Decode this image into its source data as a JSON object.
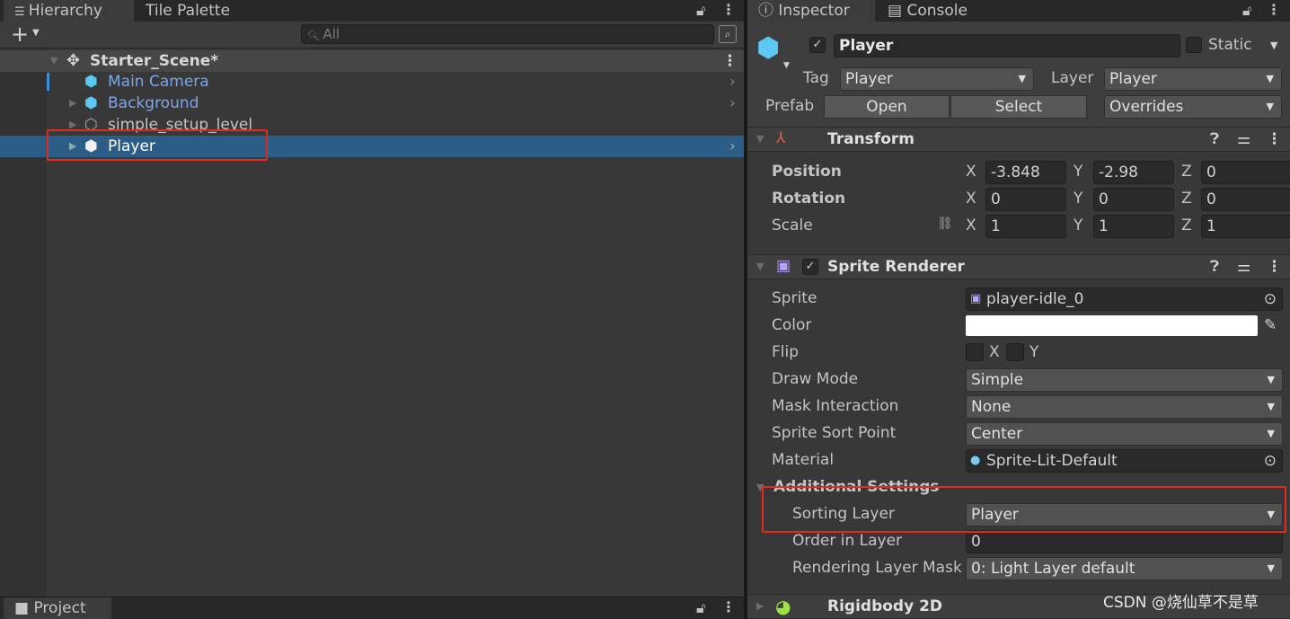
{
  "hierarchy": {
    "tabs": [
      {
        "label": "Hierarchy",
        "icon": "list-icon"
      },
      {
        "label": "Tile Palette"
      }
    ],
    "add_label": "+",
    "search_placeholder": "All",
    "scene": "Starter_Scene*",
    "items": [
      {
        "label": "Main Camera",
        "color": "#7ba7e8",
        "expandable": false
      },
      {
        "label": "Background",
        "color": "#7ba7e8",
        "expandable": true
      },
      {
        "label": "simple_setup_level",
        "color": "#c4c4c4",
        "expandable": true
      },
      {
        "label": "Player",
        "color": "#ffffff",
        "expandable": true,
        "selected": true
      }
    ]
  },
  "project": {
    "tab_label": "Project"
  },
  "inspector": {
    "tabs": [
      {
        "label": "Inspector",
        "icon": "info-icon"
      },
      {
        "label": "Console",
        "icon": "console-icon"
      }
    ],
    "object_name": "Player",
    "active": true,
    "static_label": "Static",
    "tag_label": "Tag",
    "tag_value": "Player",
    "layer_label": "Layer",
    "layer_value": "Player",
    "prefab_label": "Prefab",
    "open_label": "Open",
    "select_label": "Select",
    "overrides_label": "Overrides",
    "transform": {
      "title": "Transform",
      "rows": [
        {
          "label": "Position",
          "x": "-3.848",
          "y": "-2.98",
          "z": "0"
        },
        {
          "label": "Rotation",
          "x": "0",
          "y": "0",
          "z": "0"
        },
        {
          "label": "Scale",
          "x": "1",
          "y": "1",
          "z": "1"
        }
      ],
      "axis": {
        "x": "X",
        "y": "Y",
        "z": "Z"
      }
    },
    "sprite_renderer": {
      "title": "Sprite Renderer",
      "enabled": true,
      "sprite_label": "Sprite",
      "sprite_value": "player-idle_0",
      "color_label": "Color",
      "color_value": "#ffffff",
      "flip_label": "Flip",
      "flip_x": "X",
      "flip_y": "Y",
      "draw_mode_label": "Draw Mode",
      "draw_mode_value": "Simple",
      "mask_label": "Mask Interaction",
      "mask_value": "None",
      "sort_point_label": "Sprite Sort Point",
      "sort_point_value": "Center",
      "material_label": "Material",
      "material_value": "Sprite-Lit-Default",
      "additional_label": "Additional Settings",
      "sorting_layer_label": "Sorting Layer",
      "sorting_layer_value": "Player",
      "order_label": "Order in Layer",
      "order_value": "0",
      "rendering_mask_label": "Rendering Layer Mask",
      "rendering_mask_value": "0: Light Layer default"
    },
    "rigidbody": {
      "title": "Rigidbody 2D"
    }
  },
  "watermark": "CSDN @烧仙草不是草"
}
